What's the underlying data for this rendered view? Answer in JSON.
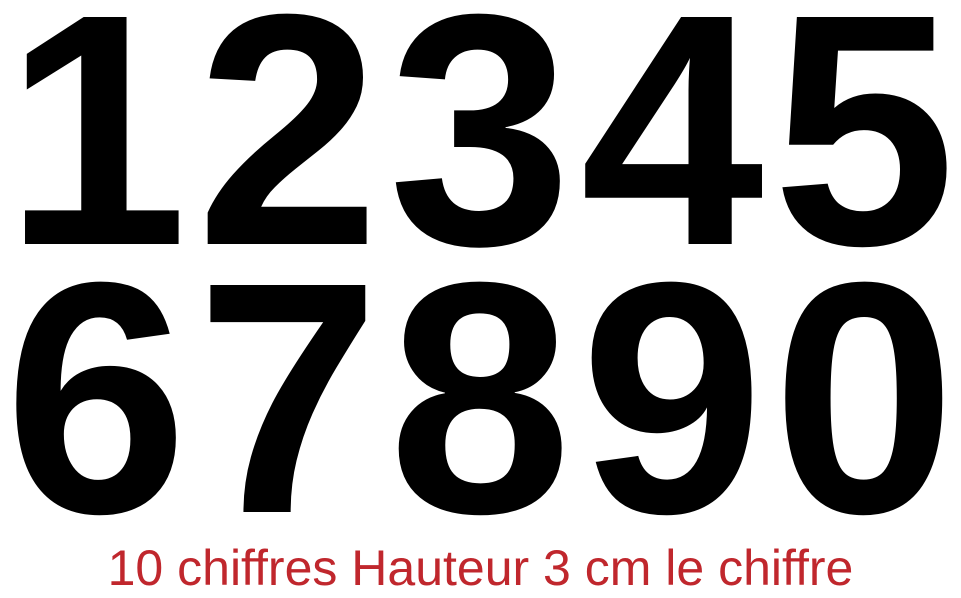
{
  "digits_top": [
    "1",
    "2",
    "3",
    "4",
    "5"
  ],
  "digits_bottom": [
    "6",
    "7",
    "8",
    "9",
    "0"
  ],
  "caption": "10 chiffres Hauteur 3 cm le chiffre",
  "colors": {
    "digits": "#000000",
    "caption": "#c0272d",
    "background": "#ffffff"
  }
}
